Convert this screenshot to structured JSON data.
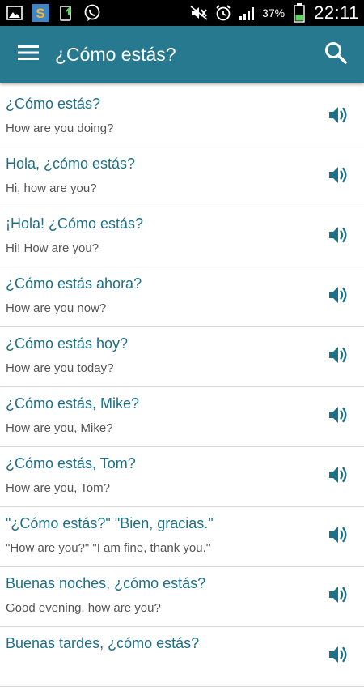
{
  "status_bar": {
    "battery": "37%",
    "time": "22:11",
    "icons": [
      "gallery-icon",
      "s-app-icon",
      "upload-icon",
      "viber-icon",
      "mute-icon",
      "alarm-icon",
      "signal-icon",
      "battery-icon"
    ]
  },
  "app_bar": {
    "title": "¿Cómo estás?",
    "menu_icon": "hamburger-menu-icon",
    "search_icon": "search-icon",
    "color": "#26798f"
  },
  "accent_text_color": "#1f6f86",
  "phrases": [
    {
      "es": "¿Cómo estás?",
      "en": "How are you doing?"
    },
    {
      "es": "Hola, ¿cómo estás?",
      "en": "Hi, how are you?"
    },
    {
      "es": "¡Hola! ¿Cómo estás?",
      "en": "Hi! How are you?"
    },
    {
      "es": "¿Cómo estás ahora?",
      "en": "How are you now?"
    },
    {
      "es": "¿Cómo estás hoy?",
      "en": "How are you today?"
    },
    {
      "es": "¿Cómo estás, Mike?",
      "en": "How are you, Mike?"
    },
    {
      "es": "¿Cómo estás, Tom?",
      "en": "How are you, Tom?"
    },
    {
      "es": "\"¿Cómo estás?\" \"Bien, gracias.\"",
      "en": "\"How are you?\" \"I am fine, thank you.\""
    },
    {
      "es": "Buenas noches, ¿cómo estás?",
      "en": "Good evening, how are you?"
    },
    {
      "es": "Buenas tardes, ¿cómo estás?",
      "en": ""
    }
  ]
}
